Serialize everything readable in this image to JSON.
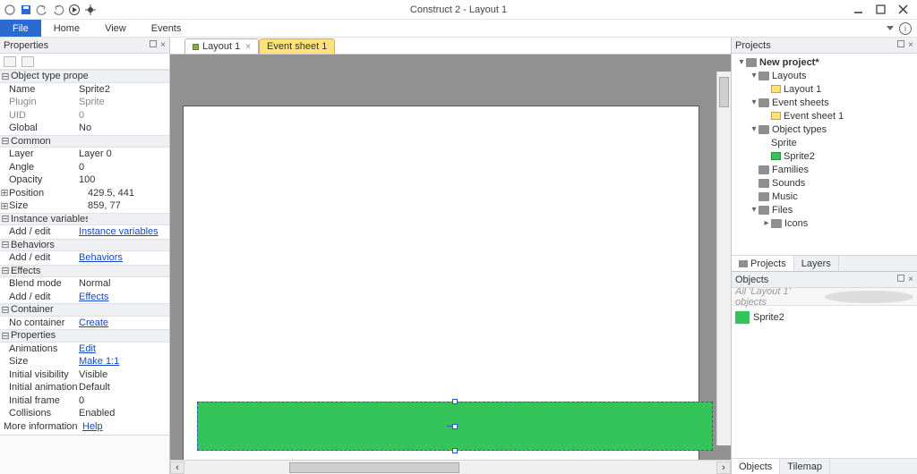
{
  "titlebar": {
    "title": "Construct 2 - Layout 1"
  },
  "menu": {
    "file": "File",
    "home": "Home",
    "view": "View",
    "events": "Events"
  },
  "properties": {
    "header": "Properties",
    "sections": {
      "objtype": "Object type properties",
      "common": "Common",
      "instvars": "Instance variables",
      "behaviors": "Behaviors",
      "effects": "Effects",
      "container": "Container",
      "props": "Properties"
    },
    "rows": {
      "name_l": "Name",
      "name_v": "Sprite2",
      "plugin_l": "Plugin",
      "plugin_v": "Sprite",
      "uid_l": "UID",
      "uid_v": "0",
      "global_l": "Global",
      "global_v": "No",
      "layer_l": "Layer",
      "layer_v": "Layer 0",
      "angle_l": "Angle",
      "angle_v": "0",
      "opacity_l": "Opacity",
      "opacity_v": "100",
      "position_l": "Position",
      "position_v": "429.5, 441",
      "size_l": "Size",
      "size_v": "859, 77",
      "addedit": "Add / edit",
      "instvars_link": "Instance variables",
      "behaviors_link": "Behaviors",
      "blend_l": "Blend mode",
      "blend_v": "Normal",
      "effects_link": "Effects",
      "nocontainer": "No container",
      "create_link": "Create",
      "anim_l": "Animations",
      "anim_v": "Edit",
      "psize_l": "Size",
      "psize_v": "Make 1:1",
      "ivis_l": "Initial visibility",
      "ivis_v": "Visible",
      "ianim_l": "Initial animation",
      "ianim_v": "Default",
      "iframe_l": "Initial frame",
      "iframe_v": "0",
      "coll_l": "Collisions",
      "coll_v": "Enabled",
      "more_l": "More information",
      "more_v": "Help"
    }
  },
  "tabs": {
    "layout": "Layout 1",
    "eventsheet": "Event sheet 1"
  },
  "projects": {
    "header": "Projects",
    "root": "New project*",
    "layouts": "Layouts",
    "layout1": "Layout 1",
    "eventsheets": "Event sheets",
    "eventsheet1": "Event sheet 1",
    "objtypes": "Object types",
    "sprite": "Sprite",
    "sprite2": "Sprite2",
    "families": "Families",
    "sounds": "Sounds",
    "music": "Music",
    "files": "Files",
    "icons": "Icons",
    "tab_projects": "Projects",
    "tab_layers": "Layers"
  },
  "objects": {
    "header": "Objects",
    "filter": "All 'Layout 1' objects",
    "item1": "Sprite2",
    "tab_objects": "Objects",
    "tab_tilemap": "Tilemap"
  }
}
